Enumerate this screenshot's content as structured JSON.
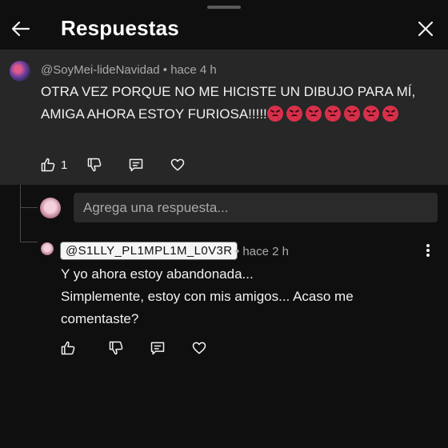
{
  "header": {
    "title": "Respuestas",
    "back_icon": "arrow-left-icon",
    "close_icon": "close-icon"
  },
  "parent_comment": {
    "author": "@SoyMei-lideNavidad",
    "time": "• hace 4 h",
    "text": "OTRA VEZ PORQUE NO ME HICISTE UN DIBUJO PARA MÍ, AMIGA AHORA ESTOY FURIOSA!!!!!",
    "emoji_count": 7,
    "emoji_icon": "angry-face-icon",
    "like_count": "1"
  },
  "reply_box": {
    "placeholder": "Agrega una respuesta..."
  },
  "reply": {
    "author": "@S1LLY_PL1MPL1M_L0V3R",
    "time": "• hace 2 h",
    "lines": [
      "Y yo ahora estoy abandonada...",
      "Simplemente, estoy con mis amigos... Acaso me",
      "comentaste?"
    ]
  },
  "colors": {
    "background": "#0f0f0f",
    "parent_bg": "#272727",
    "text": "#f1f1f1",
    "muted": "#aaaaaa",
    "emoji": "#d8304a"
  }
}
